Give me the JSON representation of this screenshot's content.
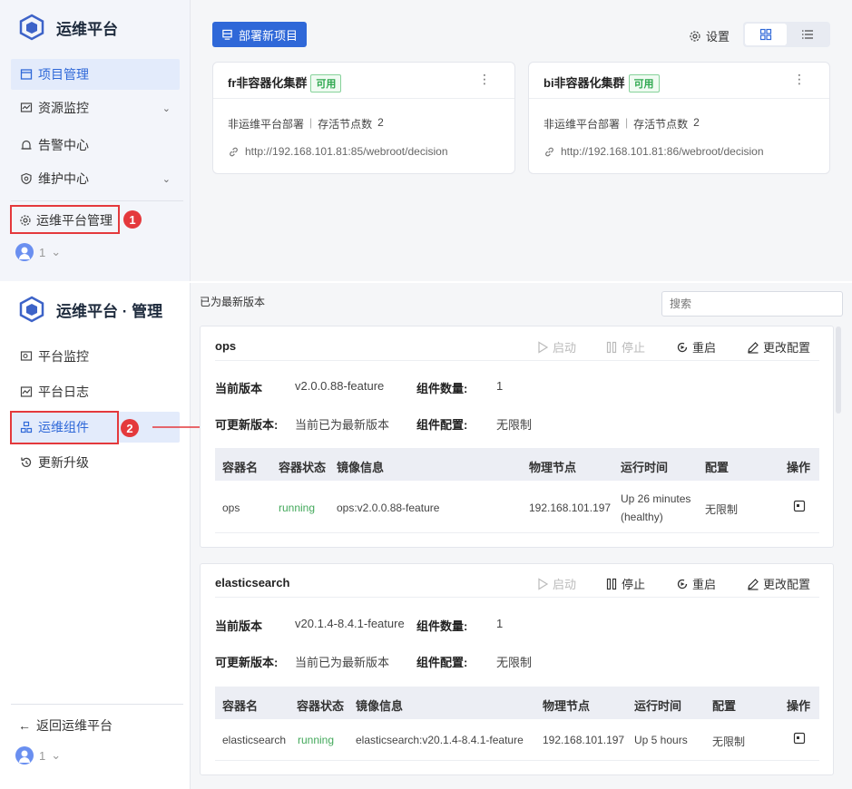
{
  "top": {
    "app_title": "运维平台",
    "nav": [
      {
        "label": "项目管理",
        "icon": "window-icon"
      },
      {
        "label": "资源监控",
        "icon": "monitor-chart-icon"
      },
      {
        "label": "告警中心",
        "icon": "bell-icon"
      },
      {
        "label": "维护中心",
        "icon": "shield-gear-icon"
      }
    ],
    "manage_label": "运维平台管理",
    "badge1": "1",
    "user": "1",
    "deploy_btn": "部署新项目",
    "settings_label": "设置",
    "cards": [
      {
        "name": "fr非容器化集群",
        "status": "可用",
        "source": "非运维平台部署",
        "sep": "|",
        "nodes_label": "存活节点数",
        "nodes": "2",
        "url": "http://192.168.101.81:85/webroot/decision"
      },
      {
        "name": "bi非容器化集群",
        "status": "可用",
        "source": "非运维平台部署",
        "sep": "|",
        "nodes_label": "存活节点数",
        "nodes": "2",
        "url": "http://192.168.101.81:86/webroot/decision"
      }
    ]
  },
  "bottom": {
    "app_title": "运维平台 · 管理",
    "nav": [
      {
        "label": "平台监控",
        "icon": "monitor-icon"
      },
      {
        "label": "平台日志",
        "icon": "log-chart-icon"
      },
      {
        "label": "运维组件",
        "icon": "component-icon"
      },
      {
        "label": "更新升级",
        "icon": "refresh-icon"
      }
    ],
    "badge2": "2",
    "back_label": "返回运维平台",
    "user": "1",
    "version_status": "已为最新版本",
    "search_placeholder": "搜索",
    "actions": {
      "start": "启动",
      "stop": "停止",
      "restart": "重启",
      "config": "更改配置"
    },
    "labels": {
      "current_version": "当前版本",
      "component_count": "组件数量:",
      "updatable": "可更新版本:",
      "component_config": "组件配置:"
    },
    "columns": [
      "容器名",
      "容器状态",
      "镜像信息",
      "物理节点",
      "运行时间",
      "配置",
      "操作"
    ],
    "components": [
      {
        "name": "ops",
        "version": "v2.0.0.88-feature",
        "count": "1",
        "updatable": "当前已为最新版本",
        "config": "无限制",
        "row": {
          "container": "ops",
          "status": "running",
          "image": "ops:v2.0.0.88-feature",
          "node": "192.168.101.197",
          "uptime_line1": "Up 26 minutes",
          "uptime_line2": "(healthy)",
          "config": "无限制"
        }
      },
      {
        "name": "elasticsearch",
        "version": "v20.1.4-8.4.1-feature",
        "count": "1",
        "updatable": "当前已为最新版本",
        "config": "无限制",
        "row": {
          "container": "elasticsearch",
          "status": "running",
          "image": "elasticsearch:v20.1.4-8.4.1-feature",
          "node": "192.168.101.197",
          "uptime_line1": "Up 5 hours",
          "uptime_line2": "",
          "config": "无限制"
        }
      }
    ],
    "colors": {
      "primary": "#2f68d8",
      "running": "#42a85a",
      "annotation": "#e4393c"
    }
  }
}
